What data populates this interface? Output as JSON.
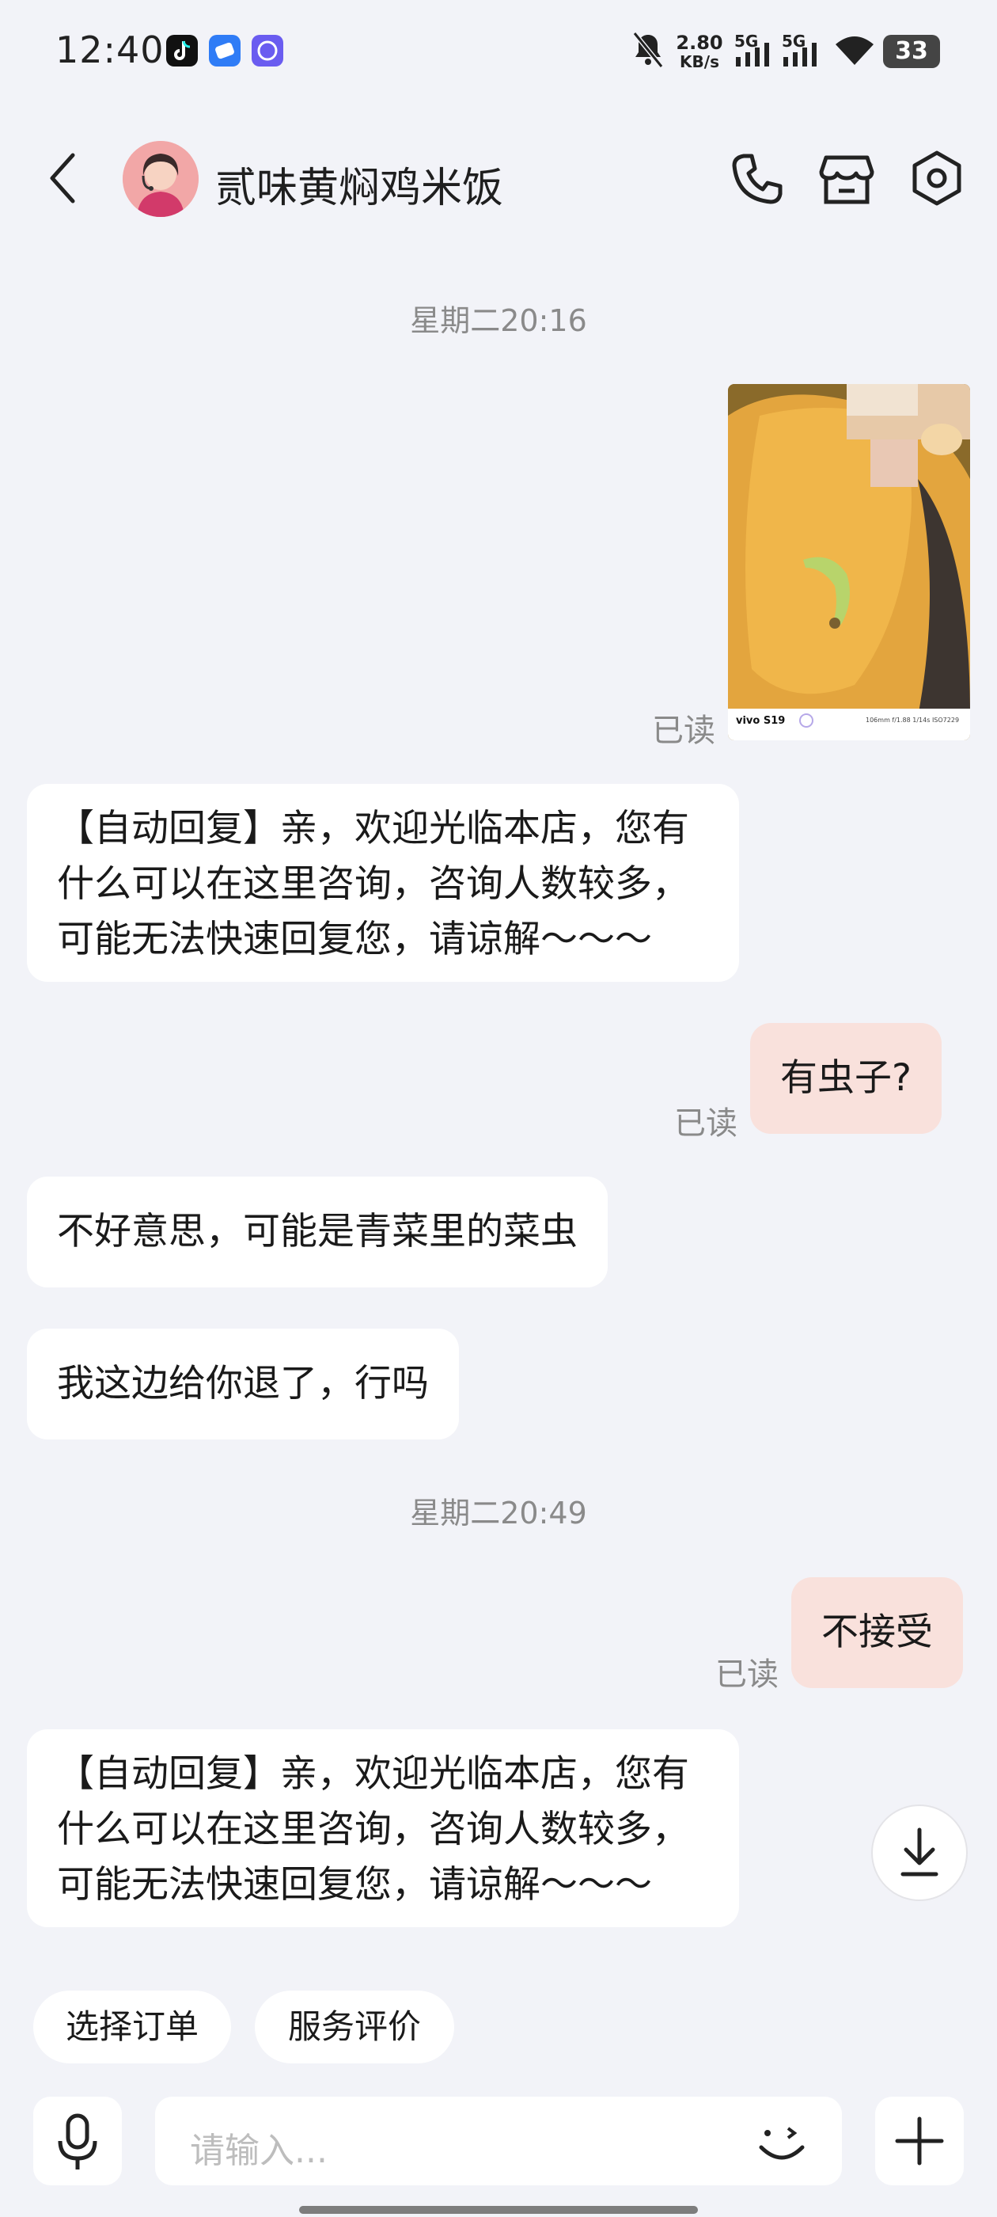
{
  "status_bar": {
    "time": "12:40",
    "net_speed_value": "2.80",
    "net_speed_unit": "KB/s",
    "sig1": "5G",
    "sig2": "5G",
    "battery": "33"
  },
  "header": {
    "title": "贰味黄焖鸡米饭",
    "icons": [
      "back-icon",
      "avatar",
      "phone-icon",
      "shop-icon",
      "settings-icon"
    ]
  },
  "messages": {
    "ts1": "星期二20:16",
    "photo_read": "已读",
    "photo_caption_brand": "vivo S19",
    "photo_caption_meta": "106mm f/1.88 1/14s ISO7229",
    "auto_reply_1": "【自动回复】亲，欢迎光临本店，您有什么可以在这里咨询，咨询人数较多，可能无法快速回复您，请谅解～～～",
    "out_1": "有虫子?",
    "out_1_read": "已读",
    "in_1": "不好意思，可能是青菜里的菜虫",
    "in_2": "我这边给你退了，行吗",
    "ts2": "星期二20:49",
    "out_2": "不接受",
    "out_2_read": "已读",
    "auto_reply_2": "【自动回复】亲，欢迎光临本店，您有什么可以在这里咨询，咨询人数较多，可能无法快速回复您，请谅解～～～"
  },
  "quick_actions": {
    "select_order": "选择订单",
    "service_review": "服务评价"
  },
  "input_bar": {
    "placeholder": "请输入..."
  },
  "colors": {
    "background": "#f2f3f8",
    "outgoing_bubble": "#f9e1dc",
    "incoming_bubble": "#ffffff"
  }
}
